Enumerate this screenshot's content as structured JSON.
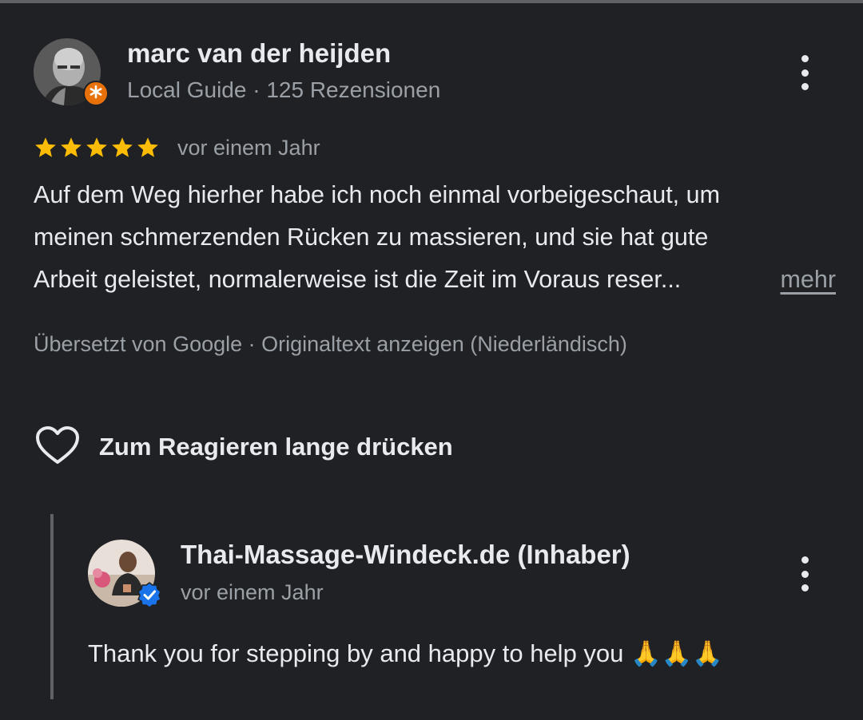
{
  "review": {
    "author": "marc van der heijden",
    "author_meta": "Local Guide · 125 Rezensionen",
    "rating": 5,
    "rating_max": 5,
    "time": "vor einem Jahr",
    "text_lines": [
      "Auf dem Weg hierher habe ich noch einmal vorbeigeschaut, um",
      "meinen schmerzenden Rücken zu massieren, und sie hat gute",
      "Arbeit geleistet, normalerweise ist die Zeit im Voraus reser..."
    ],
    "more_label": "mehr",
    "translation_note": "Übersetzt von Google · Originaltext anzeigen (Niederländisch)",
    "react_label": "Zum Reagieren lange drücken"
  },
  "owner_reply": {
    "author": "Thai-Massage-Windeck.de (Inhaber)",
    "time": "vor einem Jahr",
    "text": "Thank you for stepping by and happy to help you 🙏🙏🙏"
  },
  "colors": {
    "background": "#202124",
    "text_primary": "#e8eaed",
    "text_secondary": "#9aa0a6",
    "star": "#fbbc04",
    "local_guide_badge": "#e8710a",
    "verified_badge": "#1a73e8"
  },
  "icons": {
    "review_menu": "more-vert-icon",
    "reply_menu": "more-vert-icon",
    "react": "heart-outline-icon",
    "guide_badge": "local-guide-star-icon",
    "verified": "verified-check-icon"
  }
}
